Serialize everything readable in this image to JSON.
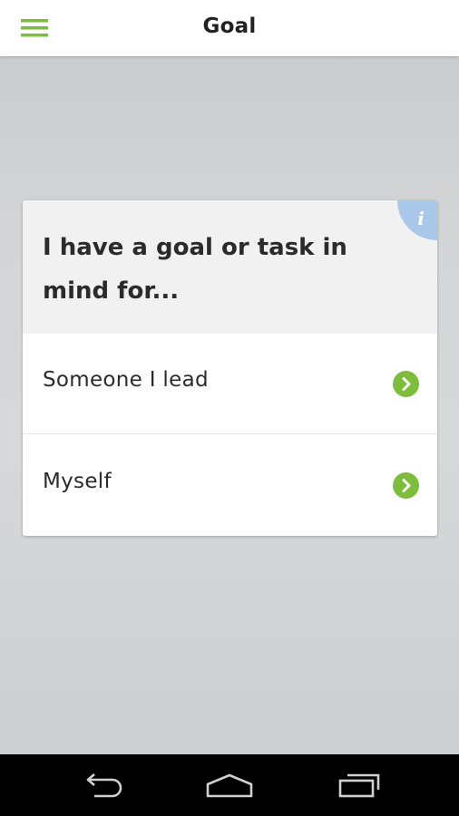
{
  "app_bar": {
    "title": "Goal",
    "menu_icon": "hamburger-menu-icon",
    "accent_color": "#7cbd3a"
  },
  "card": {
    "question": "I have a goal or task in mind for...",
    "info_icon": "info-icon",
    "info_color": "#a9c8e9",
    "options": [
      {
        "label": "Someone I lead",
        "icon": "chevron-right-circle-icon"
      },
      {
        "label": "Myself",
        "icon": "chevron-right-circle-icon"
      }
    ]
  },
  "nav_bar": {
    "back_icon": "back-arrow-icon",
    "home_icon": "home-icon",
    "recents_icon": "recent-apps-icon"
  }
}
